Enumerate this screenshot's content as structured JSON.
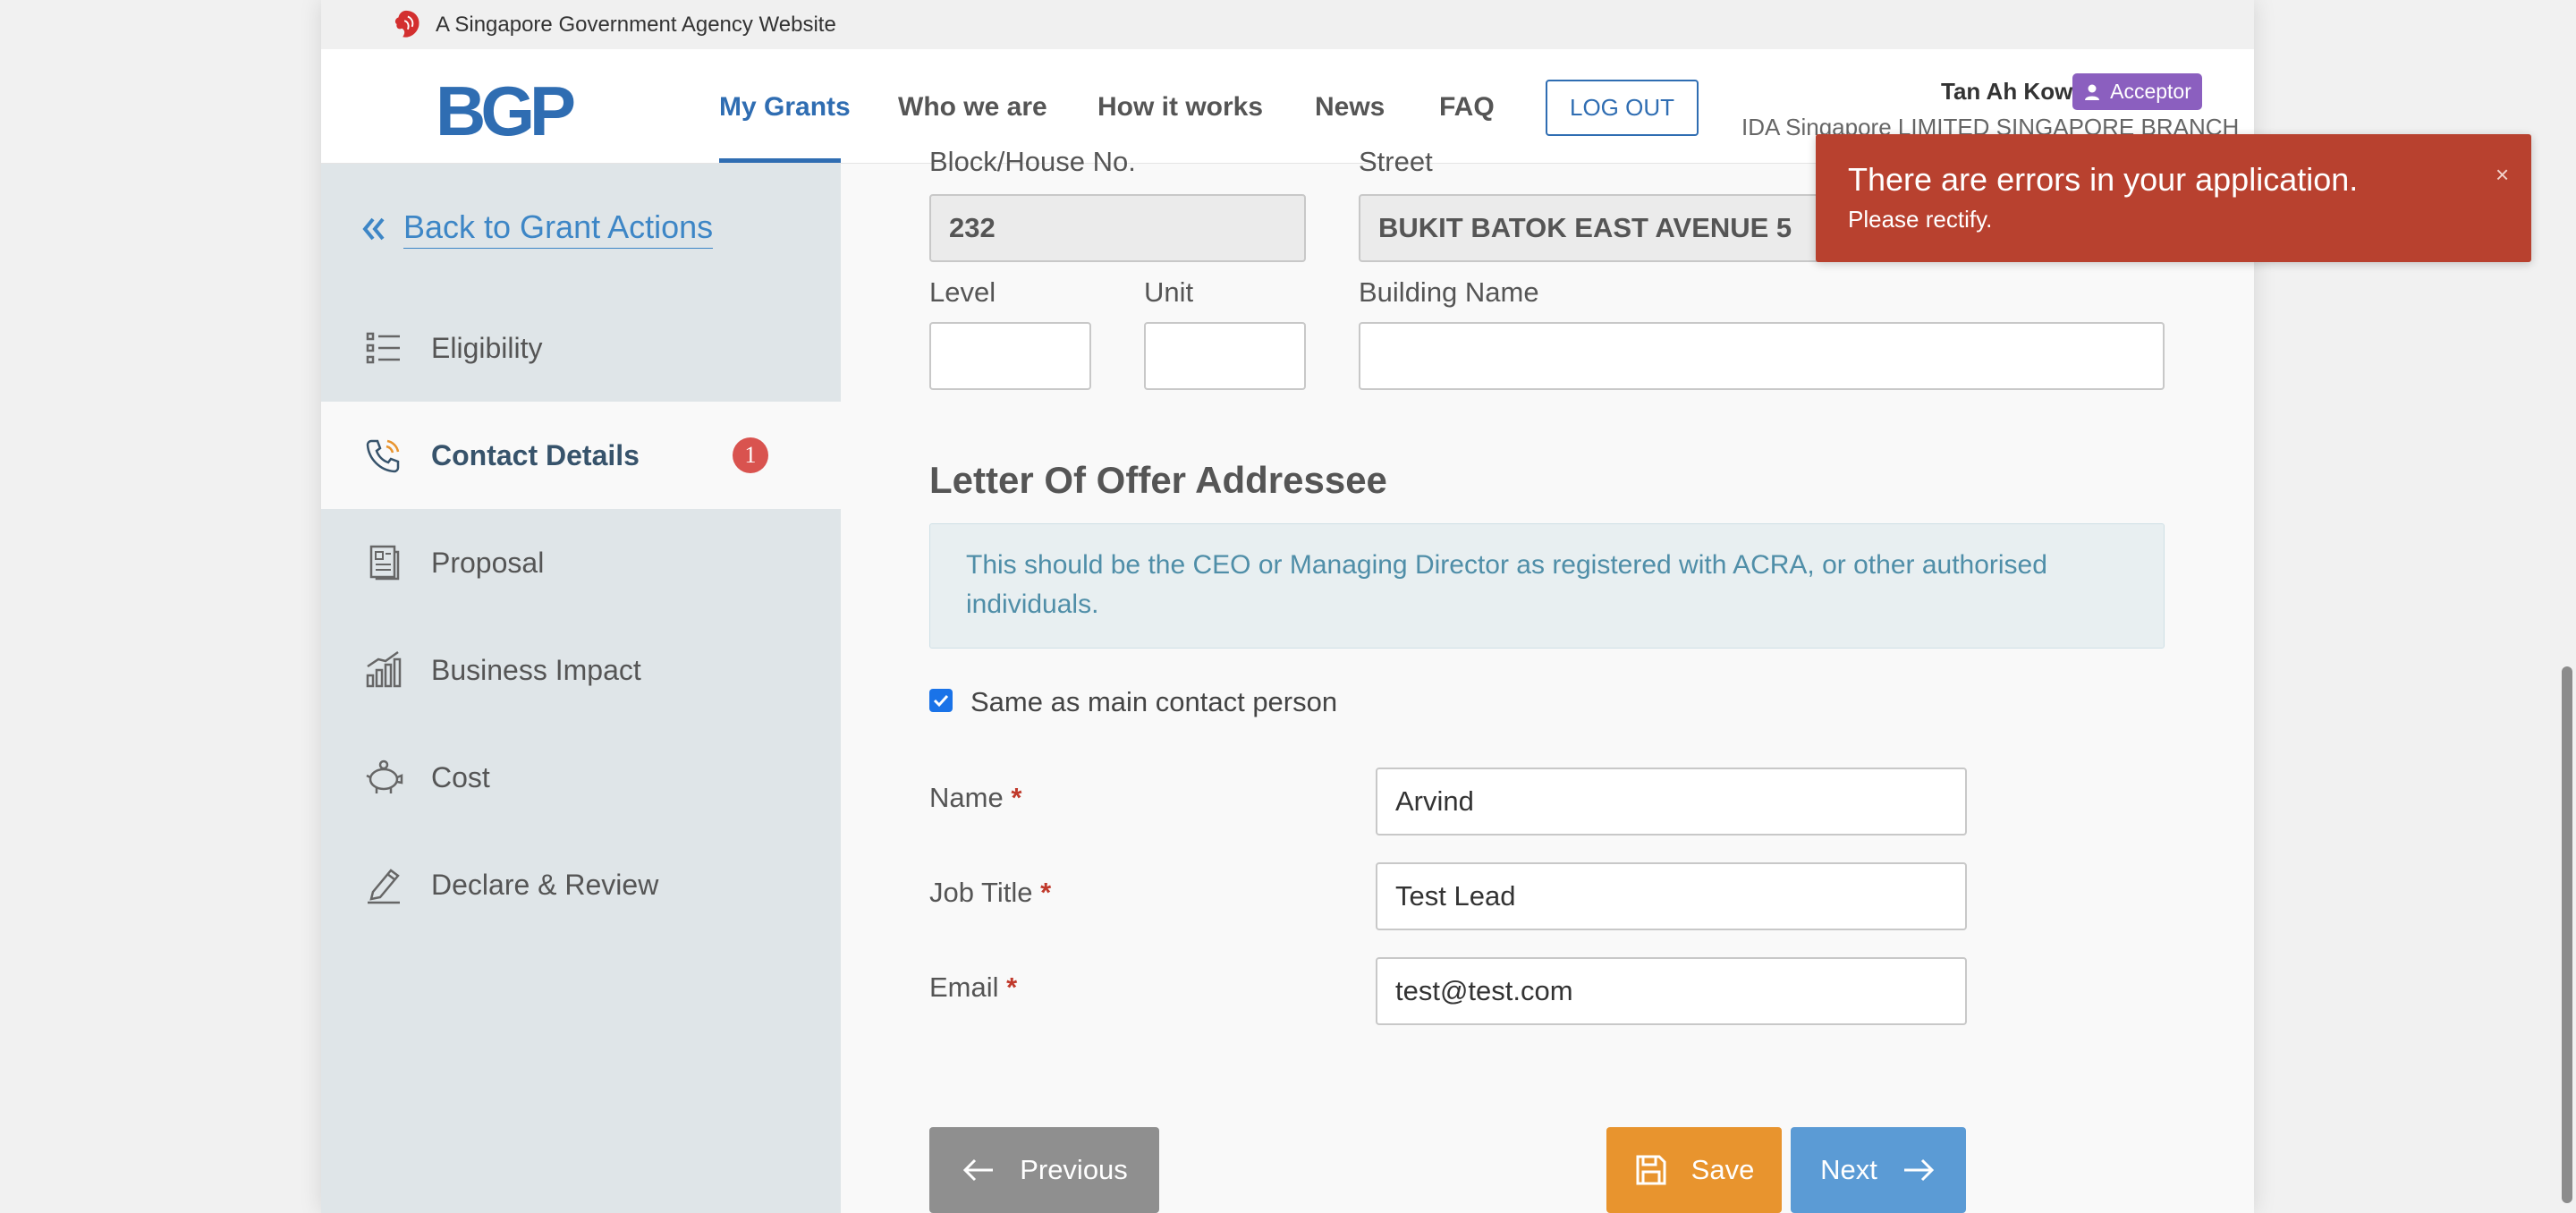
{
  "masthead": {
    "text": "A Singapore Government Agency Website"
  },
  "header": {
    "logo": "BGP",
    "nav": [
      "My Grants",
      "Who we are",
      "How it works",
      "News",
      "FAQ"
    ],
    "logout": "LOG OUT",
    "user_name": "Tan Ah Kow",
    "role": "Acceptor",
    "company": "IDA Singapore LIMITED SINGAPORE BRANCH"
  },
  "sidebar": {
    "back_label": "Back to Grant Actions",
    "items": [
      {
        "label": "Eligibility"
      },
      {
        "label": "Contact Details",
        "count": "1"
      },
      {
        "label": "Proposal"
      },
      {
        "label": "Business Impact"
      },
      {
        "label": "Cost"
      },
      {
        "label": "Declare & Review"
      }
    ]
  },
  "address": {
    "block_label": "Block/House No.",
    "block_value": "232",
    "street_label": "Street",
    "street_value": "BUKIT BATOK EAST AVENUE 5",
    "level_label": "Level",
    "level_value": "",
    "unit_label": "Unit",
    "unit_value": "",
    "building_label": "Building Name",
    "building_value": ""
  },
  "addressee": {
    "title": "Letter Of Offer Addressee",
    "info": "This should be the CEO or Managing Director as registered with ACRA, or other authorised individuals.",
    "same_as_main": "Same as main contact person",
    "same_as_main_checked": true,
    "name_label": "Name",
    "name_value": "Arvind",
    "job_label": "Job Title",
    "job_value": "Test Lead",
    "email_label": "Email",
    "email_value": "test@test.com",
    "required_mark": "*"
  },
  "actions": {
    "previous": "Previous",
    "save": "Save",
    "next": "Next"
  },
  "toast": {
    "title": "There are errors in your application.",
    "message": "Please rectify.",
    "close": "×"
  },
  "colors": {
    "brand": "#2f6db2",
    "sidebar_bg": "#dfe5e8",
    "error": "#b8412f",
    "save": "#e8942e",
    "next": "#5b9bd5",
    "previous": "#8f8f8f",
    "role_badge": "#8b5fbf"
  }
}
